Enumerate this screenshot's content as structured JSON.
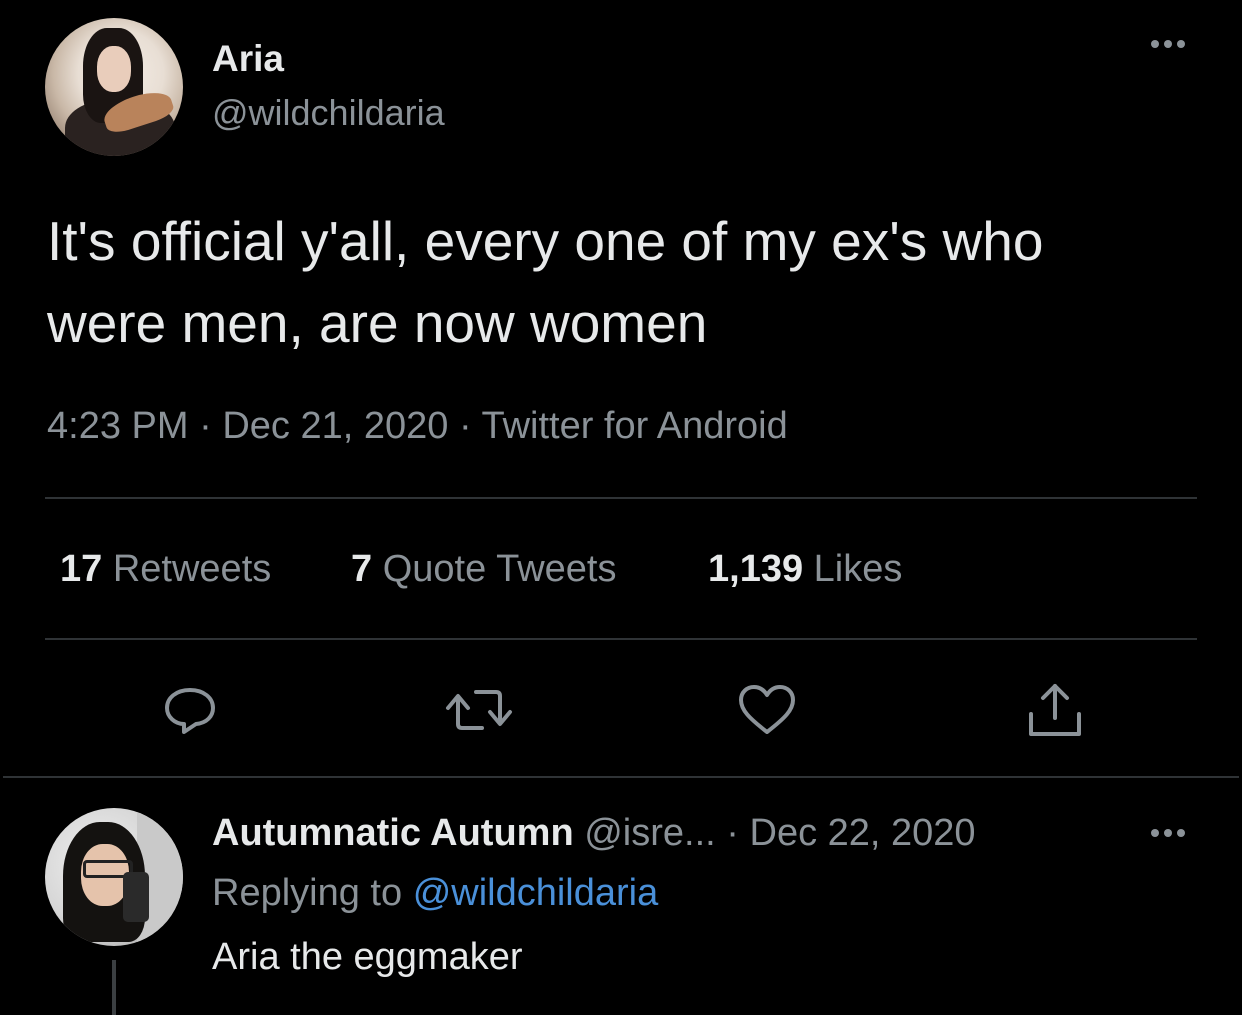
{
  "tweet": {
    "author_name": "Aria",
    "author_handle": "@wildchildaria",
    "text": "It's official y'all, every one of my ex's who\nwere men, are now women",
    "time": "4:23 PM",
    "date": "Dec 21, 2020",
    "source": "Twitter for Android",
    "separator": "·",
    "stats": {
      "retweets_count": "17",
      "retweets_label": "Retweets",
      "quotes_count": "7",
      "quotes_label": "Quote Tweets",
      "likes_count": "1,139",
      "likes_label": "Likes"
    },
    "actions": [
      "reply-icon",
      "retweet-icon",
      "like-icon",
      "share-icon"
    ]
  },
  "reply": {
    "author_name": "Autumnatic Autumn",
    "author_handle": "@isre...",
    "separator": "·",
    "date": "Dec 22, 2020",
    "replying_prefix": "Replying to",
    "replying_to": "@wildchildaria",
    "text": "Aria the eggmaker"
  },
  "colors": {
    "background": "#000000",
    "primary_text": "#e7e9ea",
    "secondary_text": "#8b9298",
    "divider": "#2f3336",
    "link": "#4a90d9"
  }
}
